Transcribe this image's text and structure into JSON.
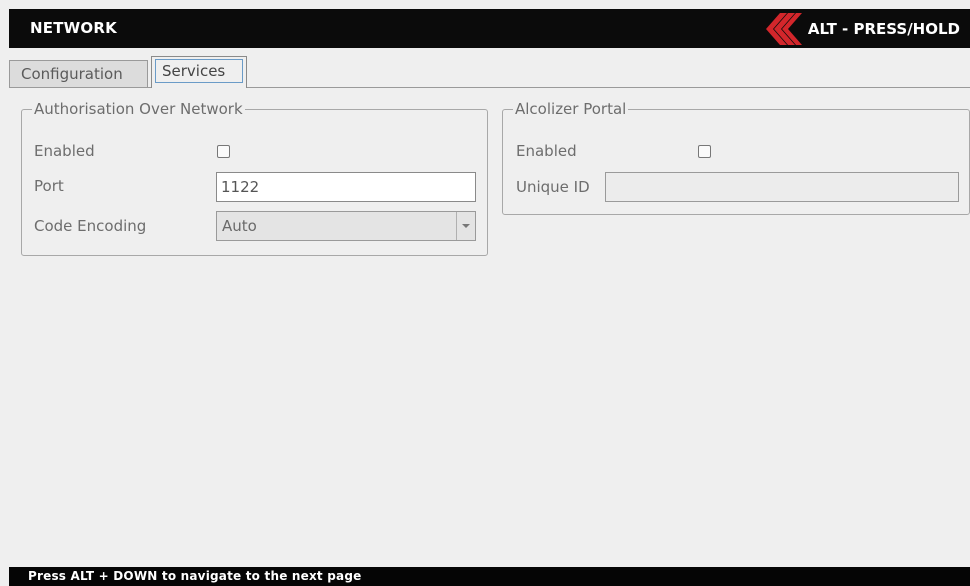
{
  "header": {
    "title": "NETWORK",
    "alt_label": "ALT - PRESS/HOLD",
    "logo_icon": "red-chevron-icon",
    "logo_color": "#d3262b"
  },
  "tabs": [
    {
      "label": "Configuration",
      "active": false
    },
    {
      "label": "Services",
      "active": true
    }
  ],
  "authorisation": {
    "legend": "Authorisation Over Network",
    "enabled_label": "Enabled",
    "enabled_checked": false,
    "port_label": "Port",
    "port_value": "1122",
    "encoding_label": "Code Encoding",
    "encoding_value": "Auto"
  },
  "alcolizer": {
    "legend": "Alcolizer Portal",
    "enabled_label": "Enabled",
    "enabled_checked": false,
    "unique_id_label": "Unique ID",
    "unique_id_value": ""
  },
  "footer": {
    "hint": "Press ALT + DOWN to navigate to the next page"
  }
}
